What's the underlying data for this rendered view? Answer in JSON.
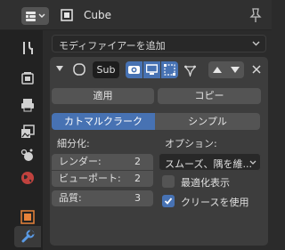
{
  "header": {
    "object_name": "Cube"
  },
  "add_modifier": {
    "label": "モディファイアーを追加"
  },
  "modifier": {
    "name": "Sub",
    "apply_label": "適用",
    "copy_label": "コピー",
    "algorithm_tabs": [
      "カトマルクラーク",
      "シンプル"
    ],
    "algorithm_selected": "カトマルクラーク",
    "subdivision_label": "細分化:",
    "render_label": "レンダー:",
    "render_value": "2",
    "viewport_label": "ビューポート:",
    "viewport_value": "2",
    "quality_label": "品質:",
    "quality_value": "3",
    "options_label": "オプション:",
    "uv_smooth": "スムーズ、隅を維...",
    "optimal_display_label": "最適化表示",
    "optimal_display_checked": false,
    "use_creases_label": "クリースを使用",
    "use_creases_checked": true
  },
  "colors": {
    "accent": "#4772b3",
    "panel": "#3d3d3d",
    "button": "#545454",
    "background": "#2b2b2b"
  }
}
